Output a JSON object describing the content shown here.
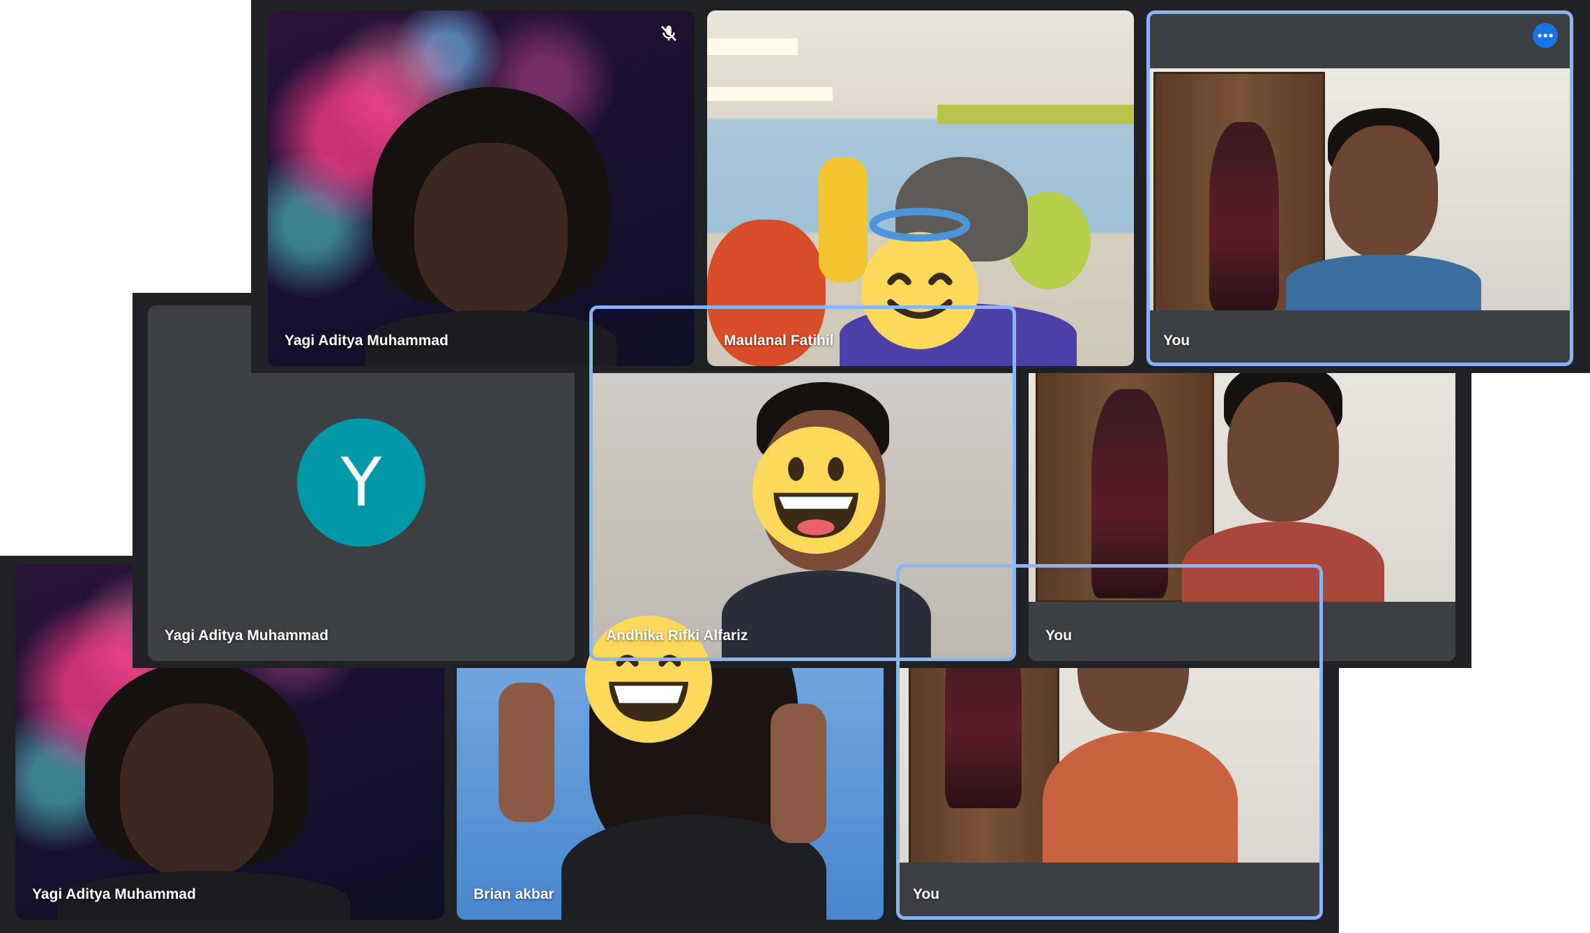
{
  "screens": [
    {
      "tiles": [
        {
          "name": "Yagi Aditya Muhammad",
          "state": "muted"
        },
        {
          "name": "Maulanal Fatihil"
        },
        {
          "name": "You",
          "state": "active-speaker"
        }
      ]
    },
    {
      "tiles": [
        {
          "name": "Yagi Aditya Muhammad",
          "avatar_letter": "Y"
        },
        {
          "name": "Andhika Rifki Alfariz",
          "state": "active-speaker"
        },
        {
          "name": "You"
        }
      ]
    },
    {
      "tiles": [
        {
          "name": "Yagi Aditya Muhammad"
        },
        {
          "name": "Brian akbar"
        },
        {
          "name": "You",
          "state": "active-speaker"
        }
      ]
    }
  ],
  "icons": {
    "mic_off": "mic-off-icon",
    "more_options": "more-options-icon",
    "emoji_halo": "smiling-face-with-halo-emoji",
    "emoji_grin": "grinning-face-emoji",
    "emoji_beam": "beaming-face-emoji"
  },
  "colors": {
    "meet_background": "#202124",
    "tile_background": "#3c4043",
    "active_border": "#8ab4f8",
    "avatar_teal": "#0097a7",
    "button_blue": "#1a73e8"
  }
}
